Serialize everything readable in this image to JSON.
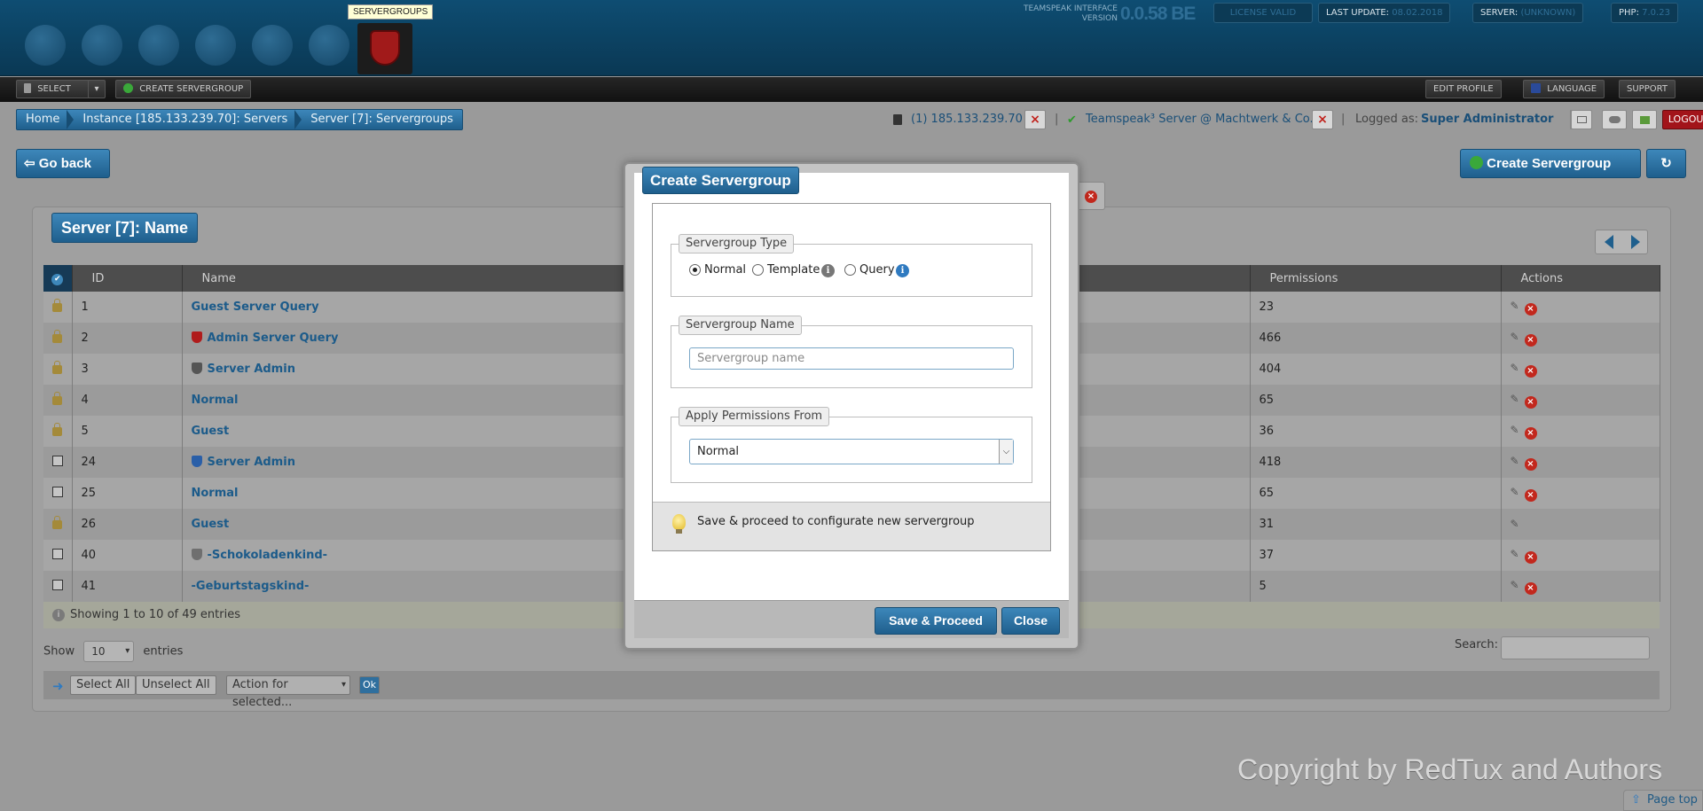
{
  "header": {
    "tooltip": "SERVERGROUPS",
    "version_label_line1": "TEAMSPEAK INTERFACE",
    "version_label_line2": "VERSION",
    "version_number": "0.0.58 BE",
    "license": "LICENSE VALID",
    "last_update_label": "LAST UPDATE:",
    "last_update_value": "08.02.2018",
    "server_label": "SERVER:",
    "server_value": "(UNKNOWN)",
    "php_label": "PHP:",
    "php_value": "7.0.23",
    "nav_icons": [
      "dashboard-icon",
      "servers-icon",
      "instance-icon",
      "globe-icon",
      "database-icon",
      "folder-icon",
      "servergroups-icon"
    ]
  },
  "toolbar": {
    "select_label": "SELECT",
    "create_servergroup_label": "CREATE SERVERGROUP",
    "edit_profile_label": "EDIT PROFILE",
    "language_label": "LANGUAGE",
    "support_label": "SUPPORT"
  },
  "breadcrumb": [
    "Home",
    "Instance [185.133.239.70]: Servers",
    "Server [7]: Servergroups"
  ],
  "status": {
    "instance_text": "(1) 185.133.239.70",
    "server_text": "Teamspeak³ Server @ Machtwerk & Co.",
    "separator": "|",
    "logged_as_label": "Logged as:",
    "user": "Super Administrator",
    "logout_label": "LOGOUT"
  },
  "actions": {
    "go_back_label": "Go back",
    "create_servergroup_label": "Create Servergroup"
  },
  "panel": {
    "title": "Server [7]: Name",
    "columns": [
      "ID",
      "Name",
      "Permissions",
      "Actions"
    ],
    "rows": [
      {
        "id": "1",
        "name": "Guest Server Query",
        "permissions": "23",
        "locked": true,
        "icon": "",
        "deletable": true
      },
      {
        "id": "2",
        "name": "Admin Server Query",
        "permissions": "466",
        "locked": true,
        "icon": "red-shield-icon",
        "deletable": true
      },
      {
        "id": "3",
        "name": "Server Admin",
        "permissions": "404",
        "locked": true,
        "icon": "grey-shield-icon",
        "deletable": true
      },
      {
        "id": "4",
        "name": "Normal",
        "permissions": "65",
        "locked": true,
        "icon": "",
        "deletable": true
      },
      {
        "id": "5",
        "name": "Guest",
        "permissions": "36",
        "locked": true,
        "icon": "",
        "deletable": true
      },
      {
        "id": "24",
        "name": "Server Admin",
        "permissions": "418",
        "locked": false,
        "icon": "blue-badge-icon",
        "deletable": true
      },
      {
        "id": "25",
        "name": "Normal",
        "permissions": "65",
        "locked": false,
        "icon": "",
        "deletable": true
      },
      {
        "id": "26",
        "name": "Guest",
        "permissions": "31",
        "locked": true,
        "icon": "",
        "deletable": false
      },
      {
        "id": "40",
        "name": "-Schokoladenkind-",
        "permissions": "37",
        "locked": false,
        "icon": "cloud-icon",
        "deletable": true
      },
      {
        "id": "41",
        "name": "-Geburtstagskind-",
        "permissions": "5",
        "locked": false,
        "icon": "",
        "deletable": true
      }
    ],
    "showing_text": "Showing 1 to 10 of 49 entries",
    "show_label": "Show",
    "page_length": "10",
    "entries_label": "entries",
    "search_label": "Search:",
    "select_all_label": "Select All",
    "unselect_all_label": "Unselect All",
    "bulk_action_placeholder": "Action for selected...",
    "ok_label": "Ok"
  },
  "modal": {
    "title": "Create Servergroup",
    "type_legend": "Servergroup Type",
    "type_options": [
      "Normal",
      "Template",
      "Query"
    ],
    "type_selected": "Normal",
    "name_legend": "Servergroup Name",
    "name_placeholder": "Servergroup name",
    "name_value": "",
    "perm_legend": "Apply Permissions From",
    "perm_selected": "Normal",
    "tip_text": "Save & proceed to configurate new servergroup",
    "save_label": "Save & Proceed",
    "close_label": "Close"
  },
  "footer": {
    "copyright": "Copyright by RedTux and Authors",
    "page_top_label": "Page top"
  },
  "colors": {
    "accent_blue": "#1f5f8d",
    "header_bg": "#0e4d72",
    "delete_red": "#c2281d",
    "logout_red": "#a2141a"
  }
}
